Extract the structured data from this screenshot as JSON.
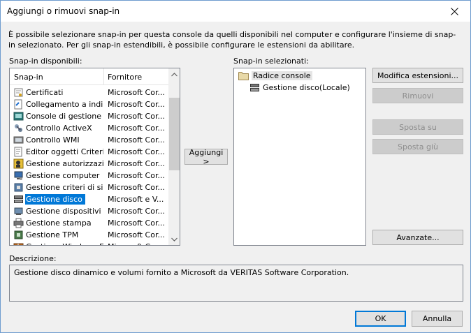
{
  "window": {
    "title": "Aggiungi o rimuovi snap-in"
  },
  "intro_text": "È possibile selezionare snap-in per questa console da quelli disponibili nel computer e configurare l'insieme di snap-in selezionato. Per gli snap-in estendibili, è possibile configurare le estensioni da abilitare.",
  "available": {
    "label": "Snap-in disponibili:",
    "columns": {
      "name": "Snap-in",
      "vendor": "Fornitore"
    },
    "items": [
      {
        "name": "Certificati",
        "vendor": "Microsoft Cor...",
        "icon": "certificate-icon"
      },
      {
        "name": "Collegamento a indir...",
        "vendor": "Microsoft Cor...",
        "icon": "link-icon"
      },
      {
        "name": "Console di gestione ...",
        "vendor": "Microsoft Cor...",
        "icon": "console-icon"
      },
      {
        "name": "Controllo ActiveX",
        "vendor": "Microsoft Cor...",
        "icon": "activex-icon"
      },
      {
        "name": "Controllo WMI",
        "vendor": "Microsoft Cor...",
        "icon": "wmi-icon"
      },
      {
        "name": "Editor oggetti Criteri...",
        "vendor": "Microsoft Cor...",
        "icon": "policy-editor-icon"
      },
      {
        "name": "Gestione autorizzazioni",
        "vendor": "Microsoft Cor...",
        "icon": "authorization-icon"
      },
      {
        "name": "Gestione computer",
        "vendor": "Microsoft Cor...",
        "icon": "computer-management-icon"
      },
      {
        "name": "Gestione criteri di sic...",
        "vendor": "Microsoft Cor...",
        "icon": "security-policy-icon"
      },
      {
        "name": "Gestione disco",
        "vendor": "Microsoft e V...",
        "icon": "disk-icon",
        "selected": true
      },
      {
        "name": "Gestione dispositivi",
        "vendor": "Microsoft Cor...",
        "icon": "device-manager-icon"
      },
      {
        "name": "Gestione stampa",
        "vendor": "Microsoft Cor...",
        "icon": "printer-icon"
      },
      {
        "name": "Gestione TPM",
        "vendor": "Microsoft Cor...",
        "icon": "tpm-icon"
      },
      {
        "name": "Gestione Windows Ef...",
        "vendor": "Microsoft Cor...",
        "icon": "firewall-icon"
      }
    ]
  },
  "add_button": "Aggiungi >",
  "selected": {
    "label": "Snap-in selezionati:",
    "root": "Radice console",
    "children": [
      "Gestione disco(Locale)"
    ]
  },
  "buttons": {
    "edit_extensions": "Modifica estensioni...",
    "remove": "Rimuovi",
    "move_up": "Sposta su",
    "move_down": "Sposta giù",
    "advanced": "Avanzate...",
    "ok": "OK",
    "cancel": "Annulla"
  },
  "description": {
    "label": "Descrizione:",
    "text": "Gestione disco dinamico e volumi fornito a Microsoft da VERITAS Software Corporation."
  },
  "colors": {
    "selection": "#0078d7",
    "face": "#f0f0f0"
  }
}
